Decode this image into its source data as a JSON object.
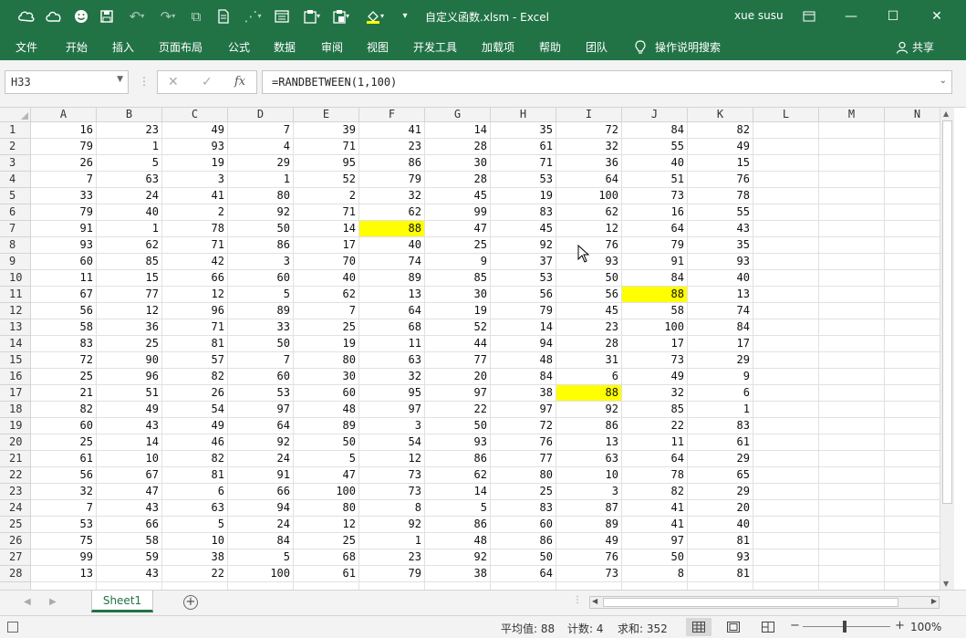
{
  "window": {
    "title": "自定义函数.xlsm  -  Excel",
    "user": "xue susu"
  },
  "ribbon": {
    "tabs": [
      "文件",
      "开始",
      "插入",
      "页面布局",
      "公式",
      "数据",
      "审阅",
      "视图",
      "开发工具",
      "加载项",
      "帮助",
      "团队"
    ],
    "tell_me": "操作说明搜索",
    "share": "共享"
  },
  "formula_bar": {
    "name_box": "H33",
    "formula": "=RANDBETWEEN(1,100)"
  },
  "grid": {
    "columns": [
      "A",
      "B",
      "C",
      "D",
      "E",
      "F",
      "G",
      "H",
      "I",
      "J",
      "K",
      "L",
      "M",
      "N"
    ],
    "row_numbers": [
      "1",
      "2",
      "3",
      "4",
      "5",
      "6",
      "7",
      "8",
      "9",
      "10",
      "11",
      "12",
      "13",
      "14",
      "15",
      "16",
      "17",
      "18",
      "19",
      "20",
      "21",
      "22",
      "23",
      "24",
      "25",
      "26",
      "27",
      "28"
    ],
    "rows": [
      [
        16,
        23,
        49,
        7,
        39,
        41,
        14,
        35,
        72,
        84,
        82
      ],
      [
        79,
        1,
        93,
        4,
        71,
        23,
        28,
        61,
        32,
        55,
        49
      ],
      [
        26,
        5,
        19,
        29,
        95,
        86,
        30,
        71,
        36,
        40,
        15
      ],
      [
        7,
        63,
        3,
        1,
        52,
        79,
        28,
        53,
        64,
        51,
        76
      ],
      [
        33,
        24,
        41,
        80,
        2,
        32,
        45,
        19,
        100,
        73,
        78
      ],
      [
        79,
        40,
        2,
        92,
        71,
        62,
        99,
        83,
        62,
        16,
        55
      ],
      [
        91,
        1,
        78,
        50,
        14,
        88,
        47,
        45,
        12,
        64,
        43
      ],
      [
        93,
        62,
        71,
        86,
        17,
        40,
        25,
        92,
        76,
        79,
        35
      ],
      [
        60,
        85,
        42,
        3,
        70,
        74,
        9,
        37,
        93,
        91,
        93
      ],
      [
        11,
        15,
        66,
        60,
        40,
        89,
        85,
        53,
        50,
        84,
        40
      ],
      [
        67,
        77,
        12,
        5,
        62,
        13,
        30,
        56,
        56,
        88,
        13
      ],
      [
        56,
        12,
        96,
        89,
        7,
        64,
        19,
        79,
        45,
        58,
        74
      ],
      [
        58,
        36,
        71,
        33,
        25,
        68,
        52,
        14,
        23,
        100,
        84
      ],
      [
        83,
        25,
        81,
        50,
        19,
        11,
        44,
        94,
        28,
        17,
        17
      ],
      [
        72,
        90,
        57,
        7,
        80,
        63,
        77,
        48,
        31,
        73,
        29
      ],
      [
        25,
        96,
        82,
        60,
        30,
        32,
        20,
        84,
        6,
        49,
        9
      ],
      [
        21,
        51,
        26,
        53,
        60,
        95,
        97,
        38,
        88,
        32,
        6
      ],
      [
        82,
        49,
        54,
        97,
        48,
        97,
        22,
        97,
        92,
        85,
        1
      ],
      [
        60,
        43,
        49,
        64,
        89,
        3,
        50,
        72,
        86,
        22,
        83
      ],
      [
        25,
        14,
        46,
        92,
        50,
        54,
        93,
        76,
        13,
        11,
        61
      ],
      [
        61,
        10,
        82,
        24,
        5,
        12,
        86,
        77,
        63,
        64,
        29
      ],
      [
        56,
        67,
        81,
        91,
        47,
        73,
        62,
        80,
        10,
        78,
        65
      ],
      [
        32,
        47,
        6,
        66,
        100,
        73,
        14,
        25,
        3,
        82,
        29
      ],
      [
        7,
        43,
        63,
        94,
        80,
        8,
        5,
        83,
        87,
        41,
        20
      ],
      [
        53,
        66,
        5,
        24,
        12,
        92,
        86,
        60,
        89,
        41,
        40
      ],
      [
        75,
        58,
        10,
        84,
        25,
        1,
        48,
        86,
        49,
        97,
        81
      ],
      [
        99,
        59,
        38,
        5,
        68,
        23,
        92,
        50,
        76,
        50,
        93
      ],
      [
        13,
        43,
        22,
        100,
        61,
        79,
        38,
        64,
        73,
        8,
        81
      ]
    ],
    "highlight_color": "#ffff00",
    "highlighted_cells": [
      [
        6,
        5
      ],
      [
        10,
        9
      ],
      [
        16,
        8
      ]
    ]
  },
  "sheets": {
    "tabs": [
      "Sheet1"
    ],
    "active": "Sheet1"
  },
  "status_bar": {
    "average": "平均值: 88",
    "count": "计数: 4",
    "sum": "求和: 352",
    "zoom": "100%"
  },
  "colors": {
    "excel_green": "#217346"
  }
}
